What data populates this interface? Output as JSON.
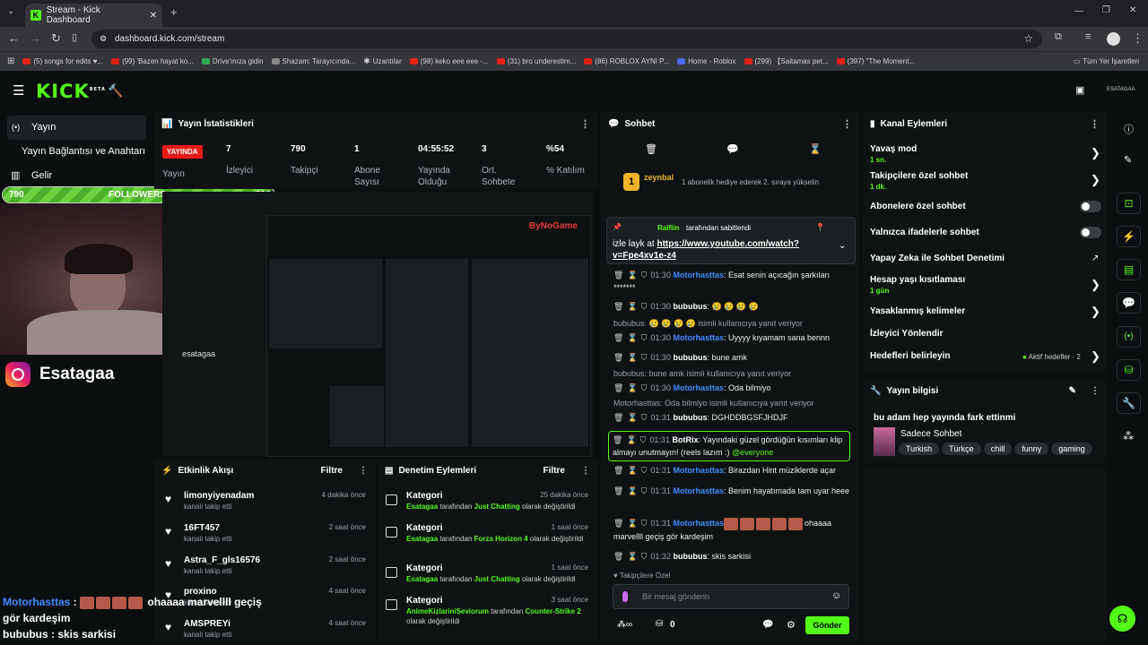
{
  "browser": {
    "tab_title": "Stream - Kick Dashboard",
    "url": "dashboard.kick.com/stream",
    "bookmarks": [
      "(5) songs for edits ♥...",
      "(99) 'Bazen hayat ko...",
      "Drive'ınıza gidin",
      "Shazam: Tarayıcında...",
      "Uzantılar",
      "(98) keko eee eee -...",
      "(31) bro underestim...",
      "(86) ROBLOX AYNI P...",
      "Home - Roblox",
      "(299) 【Saitamas pet...",
      "(397) \"The Moment...",
      "Tüm Yer İşaretleri"
    ]
  },
  "header": {
    "logo": "KICK",
    "beta": "BETA",
    "user": "ESATAGAA"
  },
  "sidebar": {
    "items": [
      "Yayın",
      "Yayın Bağlantısı ve Anahtarı",
      "Gelir"
    ]
  },
  "overlay": {
    "followers_current": "790",
    "followers_label": "FOLLOWERS",
    "followers_goal": "800",
    "followers_progress": 0.988,
    "instagram": "Esatagaa",
    "chat_user1": "Motorhasttas",
    "chat_msg1": "ohaaaa marvellll geçiş gör kardeşim",
    "chat_user2": "bububus",
    "chat_msg2": " : skis sarkisi",
    "preview_caption": "esatagaa",
    "byno": "ByNoGame"
  },
  "stats": {
    "title": "Yayın İstatistikleri",
    "live_badge": "YAYINDA",
    "live_label": "Yayın",
    "items": [
      {
        "value": "7",
        "label": "İzleyici"
      },
      {
        "value": "790",
        "label": "Takipçi"
      },
      {
        "value": "1",
        "label": "Abone Sayısı"
      },
      {
        "value": "04:55:52",
        "label": "Yayında Olduğu"
      },
      {
        "value": "3",
        "label": "Ort. Sohbete"
      },
      {
        "value": "%54",
        "label": "% Katılım"
      }
    ]
  },
  "chat": {
    "title": "Sohbet",
    "top_user": "zeynbal",
    "top_rank": "1",
    "top_note": "1 abonelik hediye ederek 2. sıraya yükselin",
    "pinned_by": "Ralfiin",
    "pinned_label": "tarafından sabitlendi",
    "pinned_text": "izle layk at ",
    "pinned_link": "https://www.youtube.com/watch?v=Fpe4xv1e-z4",
    "messages": [
      {
        "time": "01:30",
        "user": "Motorhasttas",
        "text": ": Esat senin açıcağın şarkıları *******"
      },
      {
        "time": "01:30",
        "user": "bububus",
        "text": ": 😢 😢 😢 😢"
      },
      {
        "reply": "bububus: 😢 😢 😢 😢 isimli kullanıcıya yanıt veriyor"
      },
      {
        "time": "01:30",
        "user": "Motorhasttas",
        "text": ": Uyyyy kıyamam sana bennn"
      },
      {
        "time": "01:30",
        "user": "bububus",
        "text": ": bune amk"
      },
      {
        "reply": "bububus: bune amk isimli kullanıcıya yanıt veriyor"
      },
      {
        "time": "01:30",
        "user": "Motorhasttas",
        "text": ": Oda bilmiyo"
      },
      {
        "reply": "Motorhasttas: Oda bilmiyo isimli kullanıcıya yanıt veriyor"
      },
      {
        "time": "01:31",
        "user": "bububus",
        "text": ": DGHDDBGSFJHDJF"
      },
      {
        "time": "01:31",
        "user": "BotRix",
        "text": ": Yayındaki güzel gördüğün kısımları klip almayı unutmayın! (reels lazım :) ",
        "mention": "@everyone"
      },
      {
        "time": "01:31",
        "user": "Motorhasttas",
        "text": ": Birazdan Hint müziklerde açar"
      },
      {
        "time": "01:31",
        "user": "Motorhasttas",
        "text": ": Benim hayatımada tam uyar heee"
      },
      {
        "time": "01:31",
        "user": "Motorhasttas",
        "text": "ohaaaa marvellll geçiş gör kardeşim"
      },
      {
        "time": "01:32",
        "user": "bububus",
        "text": ": skis sarkisi"
      }
    ],
    "followers_only": "Takipçilere Özel",
    "input_placeholder": "Bir mesaj gönderin",
    "points": "0",
    "send": "Gönder"
  },
  "channel": {
    "title": "Kanal Eylemleri",
    "actions": [
      {
        "label": "Yavaş mod",
        "sub": "1 sn."
      },
      {
        "label": "Takipçilere özel sohbet",
        "sub": "1 dk."
      },
      {
        "label": "Abonelere özel sohbet"
      },
      {
        "label": "Yalnızca ifadelerle sohbet"
      },
      {
        "label": "Yapay Zeka ile Sohbet Denetimi"
      },
      {
        "label": "Hesap yaşı kısıtlaması",
        "sub": "1 gün"
      },
      {
        "label": "Yasaklanmış kelimeler"
      },
      {
        "label": "İzleyici Yönlendir"
      },
      {
        "label": "Hedefleri belirleyin",
        "extra": "Aktif hedefler - 2"
      }
    ]
  },
  "streaminfo": {
    "title": "Yayın bilgisi",
    "stream_title": "bu adam hep yayında fark ettinmi",
    "category": "Sadece Sohbet",
    "tags": [
      "Turkish",
      "Türkçe",
      "chill",
      "funny",
      "gaming"
    ]
  },
  "activity": {
    "title": "Etkinlik Akışı",
    "filter": "Filtre",
    "events": [
      {
        "name": "limonyiyenadam",
        "sub": "kanalı takip etti",
        "time": "4 dakika önce"
      },
      {
        "name": "16FT457",
        "sub": "kanalı takip etti",
        "time": "2 saat önce"
      },
      {
        "name": "Astra_F_gls16576",
        "sub": "kanalı takip etti",
        "time": "2 saat önce"
      },
      {
        "name": "proxino",
        "sub": "kanalı takip etti",
        "time": "4 saat önce"
      },
      {
        "name": "AMSPREYi",
        "sub": "kanalı takip etti",
        "time": "4 saat önce"
      }
    ]
  },
  "moderation": {
    "title": "Denetim Eylemleri",
    "filter": "Filtre",
    "items": [
      {
        "name": "Kategori",
        "time": "25 dakika önce",
        "who": "Esatagaa",
        "mid": " tarafından ",
        "cat": "Just Chatting",
        "end": " olarak değiştirildi"
      },
      {
        "name": "Kategori",
        "time": "1 saat önce",
        "who": "Esatagaa",
        "mid": " tarafından ",
        "cat": "Forza Horizon 4",
        "end": " olarak değiştirildi"
      },
      {
        "name": "Kategori",
        "time": "1 saat önce",
        "who": "Esatagaa",
        "mid": " tarafından ",
        "cat": "Just Chatting",
        "end": " olarak değiştirildi"
      },
      {
        "name": "Kategori",
        "time": "3 saat önce",
        "who": "AnimeKizlariniSeviorum",
        "mid": " tarafından ",
        "cat": "Counter-Strike 2",
        "end": " olarak değiştirildi"
      }
    ]
  }
}
